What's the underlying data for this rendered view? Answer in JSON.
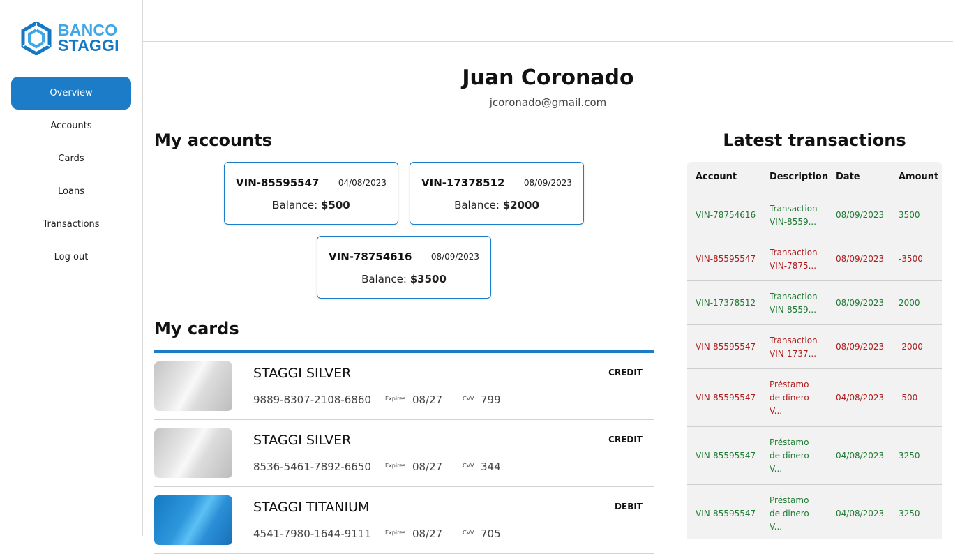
{
  "brand": {
    "line1": "BANCO",
    "line2": "STAGGI",
    "colors": {
      "primary": "#1c7cc7",
      "light": "#3fa6e8"
    }
  },
  "nav": {
    "items": [
      {
        "label": "Overview",
        "active": true
      },
      {
        "label": "Accounts",
        "active": false
      },
      {
        "label": "Cards",
        "active": false
      },
      {
        "label": "Loans",
        "active": false
      },
      {
        "label": "Transactions",
        "active": false
      },
      {
        "label": "Log out",
        "active": false
      }
    ]
  },
  "profile": {
    "name": "Juan Coronado",
    "email": "jcoronado@gmail.com"
  },
  "accounts": {
    "title": "My accounts",
    "balance_label": "Balance: ",
    "items": [
      {
        "number": "VIN-85595547",
        "date": "04/08/2023",
        "balance": "$500"
      },
      {
        "number": "VIN-17378512",
        "date": "08/09/2023",
        "balance": "$2000"
      },
      {
        "number": "VIN-78754616",
        "date": "08/09/2023",
        "balance": "$3500"
      }
    ]
  },
  "cards": {
    "title": "My cards",
    "expires_label": "Expires",
    "cvv_label": "CVV",
    "items": [
      {
        "name": "STAGGI SILVER",
        "type": "CREDIT",
        "number": "9889-8307-2108-6860",
        "expires": "08/27",
        "cvv": "799",
        "style": "silver"
      },
      {
        "name": "STAGGI SILVER",
        "type": "CREDIT",
        "number": "8536-5461-7892-6650",
        "expires": "08/27",
        "cvv": "344",
        "style": "silver"
      },
      {
        "name": "STAGGI TITANIUM",
        "type": "DEBIT",
        "number": "4541-7980-1644-9111",
        "expires": "08/27",
        "cvv": "705",
        "style": "titanium"
      }
    ]
  },
  "transactions": {
    "title": "Latest transactions",
    "headers": {
      "account": "Account",
      "description": "Description",
      "date": "Date",
      "amount": "Amount"
    },
    "rows": [
      {
        "account": "VIN-78754616",
        "desc1": "Transaction",
        "desc2": "VIN-8559...",
        "desc3": "",
        "date": "08/09/2023",
        "amount": "3500",
        "sign": "pos"
      },
      {
        "account": "VIN-85595547",
        "desc1": "Transaction",
        "desc2": "VIN-7875...",
        "desc3": "",
        "date": "08/09/2023",
        "amount": "-3500",
        "sign": "neg"
      },
      {
        "account": "VIN-17378512",
        "desc1": "Transaction",
        "desc2": "VIN-8559...",
        "desc3": "",
        "date": "08/09/2023",
        "amount": "2000",
        "sign": "pos"
      },
      {
        "account": "VIN-85595547",
        "desc1": "Transaction",
        "desc2": "VIN-1737...",
        "desc3": "",
        "date": "08/09/2023",
        "amount": "-2000",
        "sign": "neg"
      },
      {
        "account": "VIN-85595547",
        "desc1": "Préstamo",
        "desc2": "de dinero",
        "desc3": "V...",
        "date": "04/08/2023",
        "amount": "-500",
        "sign": "neg"
      },
      {
        "account": "VIN-85595547",
        "desc1": "Préstamo",
        "desc2": "de dinero",
        "desc3": "V...",
        "date": "04/08/2023",
        "amount": "3250",
        "sign": "pos"
      },
      {
        "account": "VIN-85595547",
        "desc1": "Préstamo",
        "desc2": "de dinero",
        "desc3": "V...",
        "date": "04/08/2023",
        "amount": "3250",
        "sign": "pos"
      }
    ]
  }
}
